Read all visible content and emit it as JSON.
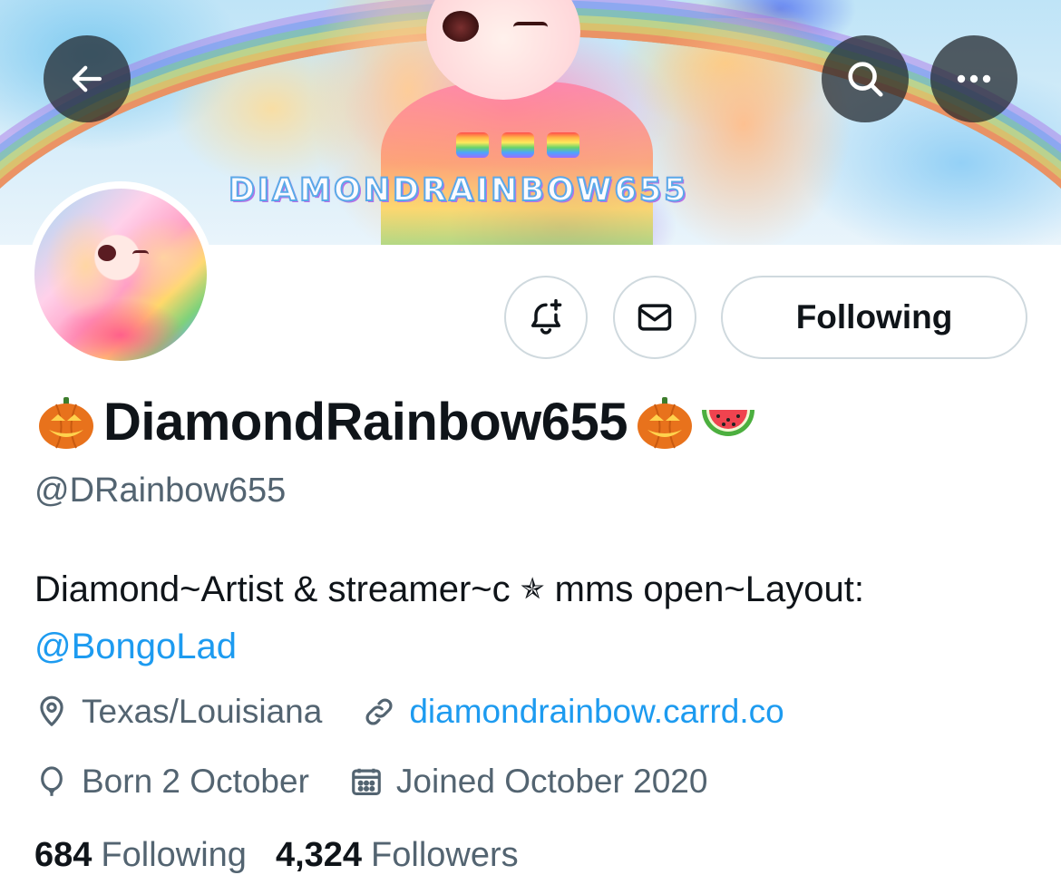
{
  "banner": {
    "title_art_text": "DIAMONDRAINBOW655"
  },
  "nav": {
    "back_icon": "arrow-left-icon",
    "search_icon": "search-icon",
    "more_icon": "more-horizontal-icon"
  },
  "actions": {
    "notify_icon": "bell-plus-icon",
    "message_icon": "envelope-icon",
    "following_label": "Following"
  },
  "profile": {
    "display_name": "DiamondRainbow655",
    "name_emojis": [
      "jack-o-lantern",
      "jack-o-lantern",
      "watermelon"
    ],
    "handle": "@DRainbow655",
    "bio_text": "Diamond~Artist & streamer~c ",
    "bio_star": "✯",
    "bio_text_2": " mms open~Layout:",
    "bio_mention": "@BongoLad",
    "location": "Texas/Louisiana",
    "website": "diamondrainbow.carrd.co",
    "birthday": "Born 2 October",
    "joined": "Joined October 2020",
    "following_count": "684",
    "following_label": "Following",
    "followers_count": "4,324",
    "followers_label": "Followers"
  },
  "colors": {
    "link": "#1d9bf0",
    "text_primary": "#0f1419",
    "text_secondary": "#536471",
    "border": "#cfd9de"
  }
}
